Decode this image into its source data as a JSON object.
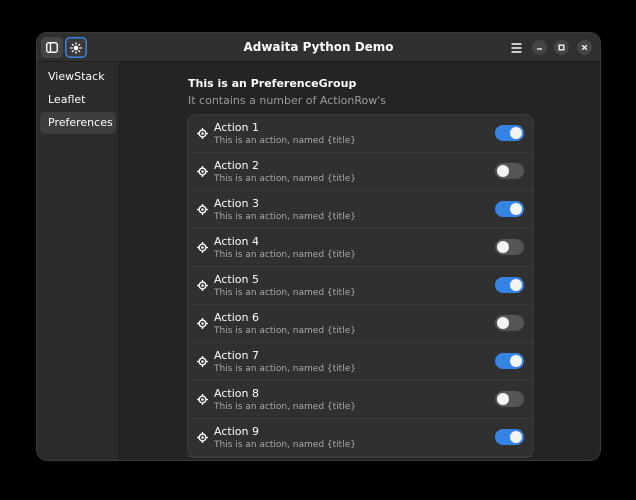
{
  "window": {
    "title": "Adwaita Python Demo"
  },
  "headerbar": {
    "sidebar_toggle_icon": "sidebar-show-icon",
    "theme_icon": "sun-icon",
    "menu_icon": "hamburger-menu-icon",
    "window_controls": [
      "minimize",
      "maximize",
      "close"
    ]
  },
  "sidebar": {
    "items": [
      {
        "label": "ViewStack",
        "selected": false
      },
      {
        "label": "Leaflet",
        "selected": false
      },
      {
        "label": "Preferences",
        "selected": true
      }
    ]
  },
  "preference_group": {
    "title": "This is an PreferenceGroup",
    "description": "It contains a number of ActionRow's",
    "rows": [
      {
        "title": "Action 1",
        "subtitle": "This is an action, named {title}",
        "active": true
      },
      {
        "title": "Action 2",
        "subtitle": "This is an action, named {title}",
        "active": false
      },
      {
        "title": "Action 3",
        "subtitle": "This is an action, named {title}",
        "active": true
      },
      {
        "title": "Action 4",
        "subtitle": "This is an action, named {title}",
        "active": false
      },
      {
        "title": "Action 5",
        "subtitle": "This is an action, named {title}",
        "active": true
      },
      {
        "title": "Action 6",
        "subtitle": "This is an action, named {title}",
        "active": false
      },
      {
        "title": "Action 7",
        "subtitle": "This is an action, named {title}",
        "active": true
      },
      {
        "title": "Action 8",
        "subtitle": "This is an action, named {title}",
        "active": false
      },
      {
        "title": "Action 9",
        "subtitle": "This is an action, named {title}",
        "active": true
      }
    ]
  },
  "colors": {
    "accent": "#3584e4",
    "window_bg": "#242424",
    "sidebar_bg": "#2b2b2b",
    "row_bg": "#303030"
  }
}
